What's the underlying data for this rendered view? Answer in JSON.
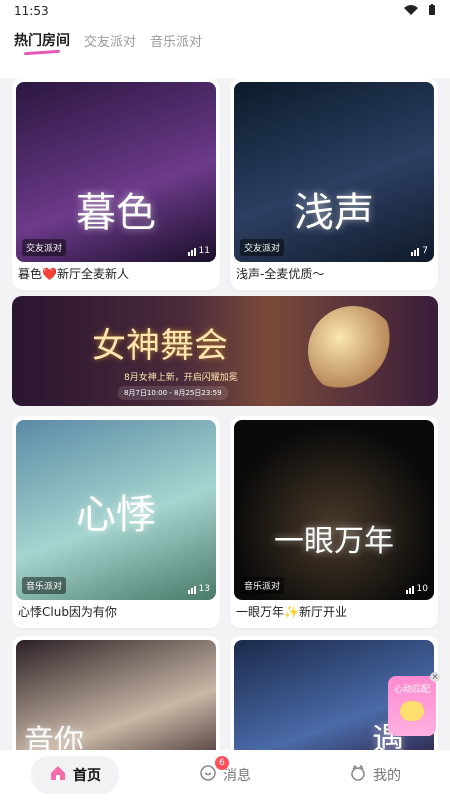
{
  "status": {
    "time": "11:53"
  },
  "tabs": [
    {
      "label": "热门房间",
      "active": true
    },
    {
      "label": "交友派对",
      "active": false
    },
    {
      "label": "音乐派对",
      "active": false
    }
  ],
  "rooms": [
    {
      "title": "暮色❤️新厅全麦新人",
      "badge": "交友派对",
      "count": "11",
      "art_text": "暮色",
      "palette": [
        "#2b1740",
        "#6c3a8a"
      ]
    },
    {
      "title": "浅声-全麦优质～",
      "badge": "交友派对",
      "count": "7",
      "art_text": "浅声",
      "palette": [
        "#0b1b2c",
        "#2d3f62"
      ]
    },
    {
      "title": "心悸Club因为有你",
      "badge": "音乐派对",
      "count": "13",
      "art_text": "心悸",
      "palette": [
        "#5c8aa6",
        "#a5d5cf"
      ]
    },
    {
      "title": "一眼万年✨新厅开业",
      "badge": "音乐派对",
      "count": "10",
      "art_text": "一眼万年",
      "palette": [
        "#0a0a0a",
        "#4a3a2a"
      ]
    },
    {
      "title": "",
      "badge": "",
      "count": "",
      "art_text": "音你",
      "palette": [
        "#2a2025",
        "#c9b7a6"
      ]
    },
    {
      "title": "",
      "badge": "",
      "count": "",
      "art_text": "遇",
      "palette": [
        "#1b2a4a",
        "#4a6aa8"
      ]
    }
  ],
  "banner": {
    "title": "女神舞会",
    "subtitle": "8月女神上新，开启闪耀加冕",
    "dates": "8月7日10:00 - 8月25日23:59"
  },
  "floating_badge": {
    "label": "心动匹配"
  },
  "nav": [
    {
      "label": "首页",
      "active": true,
      "icon": "home-icon"
    },
    {
      "label": "消息",
      "active": false,
      "badge": "6",
      "icon": "message-icon"
    },
    {
      "label": "我的",
      "active": false,
      "icon": "profile-icon"
    }
  ]
}
